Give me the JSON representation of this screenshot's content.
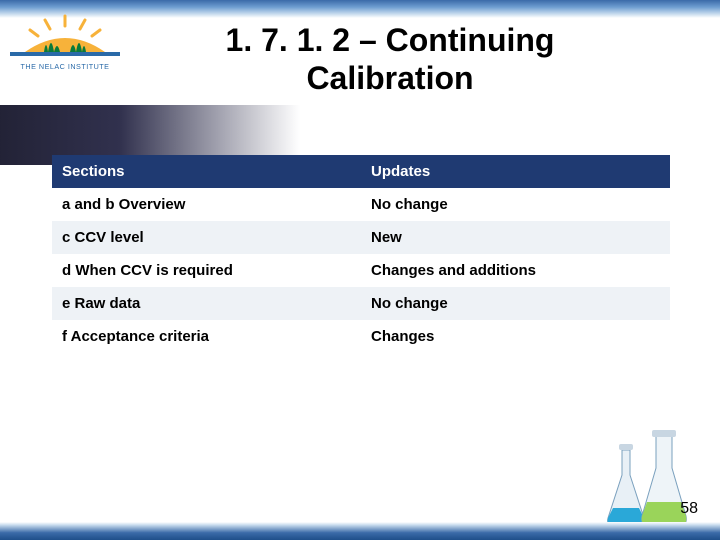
{
  "logo": {
    "caption": "THE NELAC INSTITUTE"
  },
  "title": {
    "line1": "1. 7. 1. 2 – Continuing",
    "line2": "Calibration"
  },
  "table": {
    "headers": {
      "sections": "Sections",
      "updates": "Updates"
    },
    "rows": [
      {
        "section": "a and b Overview",
        "update": "No change"
      },
      {
        "section": "c CCV level",
        "update": "New"
      },
      {
        "section": "d When CCV is required",
        "update": "Changes and additions"
      },
      {
        "section": "e Raw data",
        "update": "No change"
      },
      {
        "section": "f Acceptance criteria",
        "update": "Changes"
      }
    ]
  },
  "pageNumber": "58"
}
